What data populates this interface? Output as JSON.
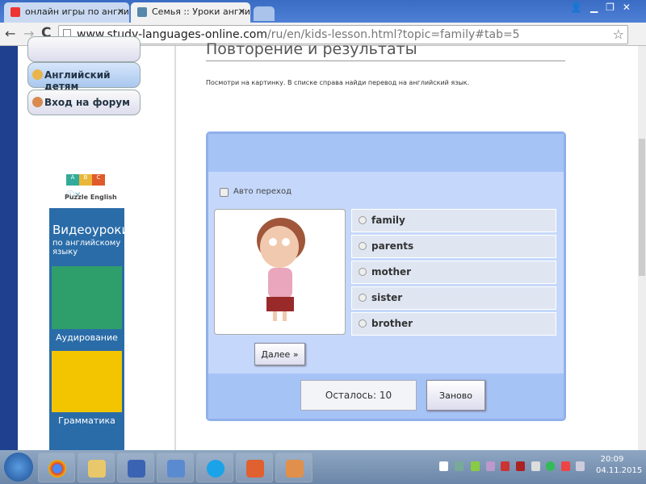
{
  "browser": {
    "tabs": [
      {
        "label": "онлайн игры по английск",
        "active": false
      },
      {
        "label": "Семья :: Уроки английск",
        "active": true
      }
    ],
    "url_host": "www.study-languages-online.com",
    "url_path": "/ru/en/kids-lesson.html?topic=family#tab=5"
  },
  "sidebar": {
    "buttons": [
      {
        "label": "Английский детям"
      },
      {
        "label": "Вход на форум"
      }
    ],
    "ad": {
      "brand": "Puzzle English",
      "letters": [
        "A",
        "B",
        "C"
      ],
      "headline": "Видеоуроки",
      "subline": "по английскому языку",
      "item1": "Аудирование",
      "item2": "Грамматика"
    }
  },
  "main": {
    "title": "Повторение и результаты",
    "instruction": "Посмотри на картинку. В списке справа найди перевод на английский язык.",
    "auto_label": "Авто переход",
    "auto_checked": false,
    "options": [
      "family",
      "parents",
      "mother",
      "sister",
      "brother"
    ],
    "next_label": "Далее »",
    "remaining_label": "Осталось: 10",
    "restart_label": "Заново"
  },
  "taskbar": {
    "time": "20:09",
    "date": "04.11.2015"
  }
}
